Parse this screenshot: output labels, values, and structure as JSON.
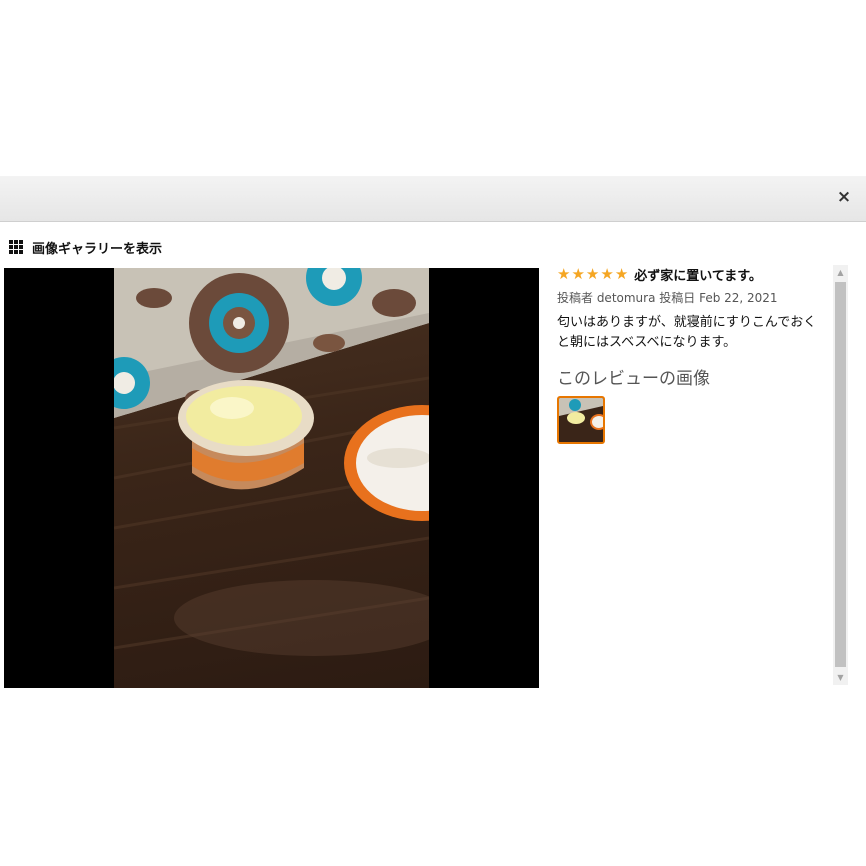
{
  "modal": {
    "close_label": "×",
    "gallery_link_label": "画像ギャラリーを表示"
  },
  "review": {
    "rating": 5,
    "stars": [
      "★",
      "★",
      "★",
      "★",
      "★"
    ],
    "title": "必ず家に置いてます。",
    "meta": "投稿者 detomura 投稿日 Feb 22, 2021",
    "body": "匂いはありますが、就寝前にすりこんでおくと朝にはスベスベになります。",
    "images_heading": "このレビューの画像"
  },
  "scrollbar": {
    "up": "▲",
    "down": "▼"
  },
  "colors": {
    "star": "#f5a623",
    "thumb_border": "#e77600",
    "cream": "#f2eca0",
    "lid": "#e8711d"
  }
}
